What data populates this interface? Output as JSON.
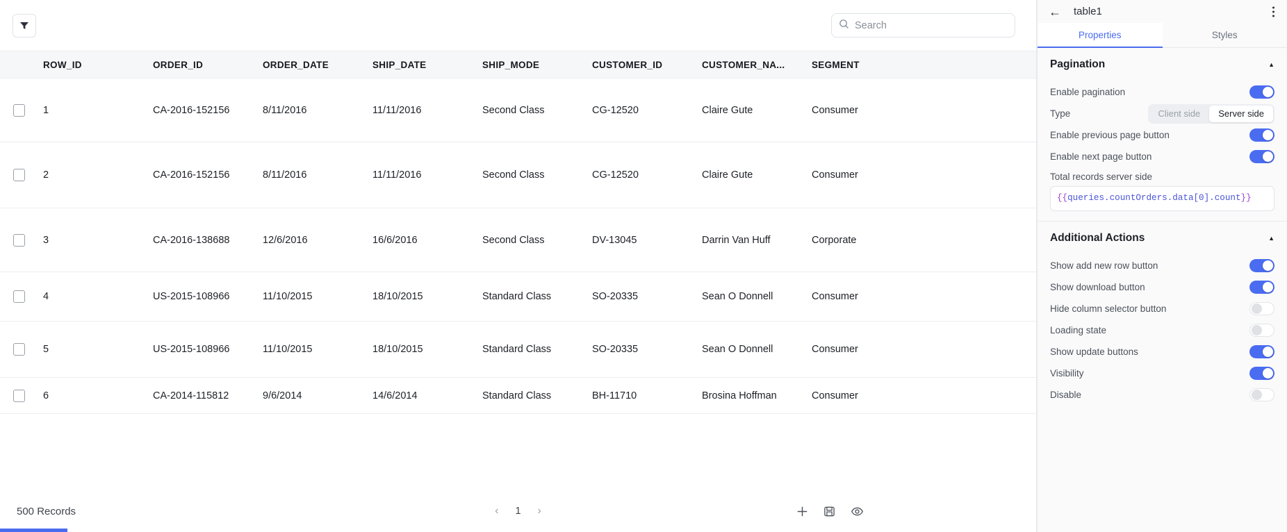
{
  "table": {
    "toolbar": {
      "filter_icon": "filter-icon",
      "search_placeholder": "Search",
      "search_value": "",
      "search_icon": "search-icon"
    },
    "columns": [
      "ROW_ID",
      "ORDER_ID",
      "ORDER_DATE",
      "SHIP_DATE",
      "SHIP_MODE",
      "CUSTOMER_ID",
      "CUSTOMER_NA...",
      "SEGMENT"
    ],
    "rows": [
      {
        "ROW_ID": "1",
        "ORDER_ID": "CA-2016-152156",
        "ORDER_DATE": "8/11/2016",
        "SHIP_DATE": "11/11/2016",
        "SHIP_MODE": "Second Class",
        "CUSTOMER_ID": "CG-12520",
        "CUSTOMER_NAME": "Claire Gute",
        "SEGMENT": "Consumer"
      },
      {
        "ROW_ID": "2",
        "ORDER_ID": "CA-2016-152156",
        "ORDER_DATE": "8/11/2016",
        "SHIP_DATE": "11/11/2016",
        "SHIP_MODE": "Second Class",
        "CUSTOMER_ID": "CG-12520",
        "CUSTOMER_NAME": "Claire Gute",
        "SEGMENT": "Consumer"
      },
      {
        "ROW_ID": "3",
        "ORDER_ID": "CA-2016-138688",
        "ORDER_DATE": "12/6/2016",
        "SHIP_DATE": "16/6/2016",
        "SHIP_MODE": "Second Class",
        "CUSTOMER_ID": "DV-13045",
        "CUSTOMER_NAME": "Darrin Van Huff",
        "SEGMENT": "Corporate"
      },
      {
        "ROW_ID": "4",
        "ORDER_ID": "US-2015-108966",
        "ORDER_DATE": "11/10/2015",
        "SHIP_DATE": "18/10/2015",
        "SHIP_MODE": "Standard Class",
        "CUSTOMER_ID": "SO-20335",
        "CUSTOMER_NAME": "Sean O Donnell",
        "SEGMENT": "Consumer"
      },
      {
        "ROW_ID": "5",
        "ORDER_ID": "US-2015-108966",
        "ORDER_DATE": "11/10/2015",
        "SHIP_DATE": "18/10/2015",
        "SHIP_MODE": "Standard Class",
        "CUSTOMER_ID": "SO-20335",
        "CUSTOMER_NAME": "Sean O Donnell",
        "SEGMENT": "Consumer"
      },
      {
        "ROW_ID": "6",
        "ORDER_ID": "CA-2014-115812",
        "ORDER_DATE": "9/6/2014",
        "SHIP_DATE": "14/6/2014",
        "SHIP_MODE": "Standard Class",
        "CUSTOMER_ID": "BH-11710",
        "CUSTOMER_NAME": "Brosina Hoffman",
        "SEGMENT": "Consumer"
      }
    ],
    "footer": {
      "records_label": "500 Records",
      "prev_arrow": "‹",
      "page_number": "1",
      "next_arrow": "›",
      "add_row_icon": "plus-icon",
      "save_icon": "save-icon",
      "preview_icon": "eye-icon"
    }
  },
  "panel": {
    "back_icon": "back-arrow-icon",
    "title": "table1",
    "menu_icon": "kebab-menu-icon",
    "tabs": [
      {
        "label": "Properties",
        "active": true
      },
      {
        "label": "Styles",
        "active": false
      }
    ],
    "sections": [
      {
        "title": "Pagination",
        "collapse_icon": "caret-up-icon",
        "rows": [
          {
            "label": "Enable pagination",
            "control": "toggle",
            "state": "on"
          },
          {
            "label": "Type",
            "control": "segmented",
            "options": [
              "Client side",
              "Server side"
            ],
            "selected": "Server side"
          },
          {
            "label": "Enable previous page button",
            "control": "toggle",
            "state": "on"
          },
          {
            "label": "Enable next page button",
            "control": "toggle",
            "state": "on"
          }
        ],
        "field": {
          "label": "Total records server side",
          "code_open": "{{",
          "code_expr": "queries.countOrders.data[0].count",
          "code_close": "}}"
        }
      },
      {
        "title": "Additional Actions",
        "collapse_icon": "caret-up-icon",
        "rows": [
          {
            "label": "Show add new row button",
            "control": "toggle",
            "state": "on"
          },
          {
            "label": "Show download button",
            "control": "toggle",
            "state": "on"
          },
          {
            "label": "Hide column selector button",
            "control": "toggle",
            "state": "off"
          },
          {
            "label": "Loading state",
            "control": "toggle",
            "state": "off"
          },
          {
            "label": "Show update buttons",
            "control": "toggle",
            "state": "on"
          },
          {
            "label": "Visibility",
            "control": "toggle",
            "state": "on"
          },
          {
            "label": "Disable",
            "control": "toggle",
            "state": "off"
          }
        ]
      }
    ]
  },
  "colors": {
    "accent": "#4a6cf0",
    "header_bg": "#f6f7f9",
    "panel_bg": "#fafafb"
  }
}
